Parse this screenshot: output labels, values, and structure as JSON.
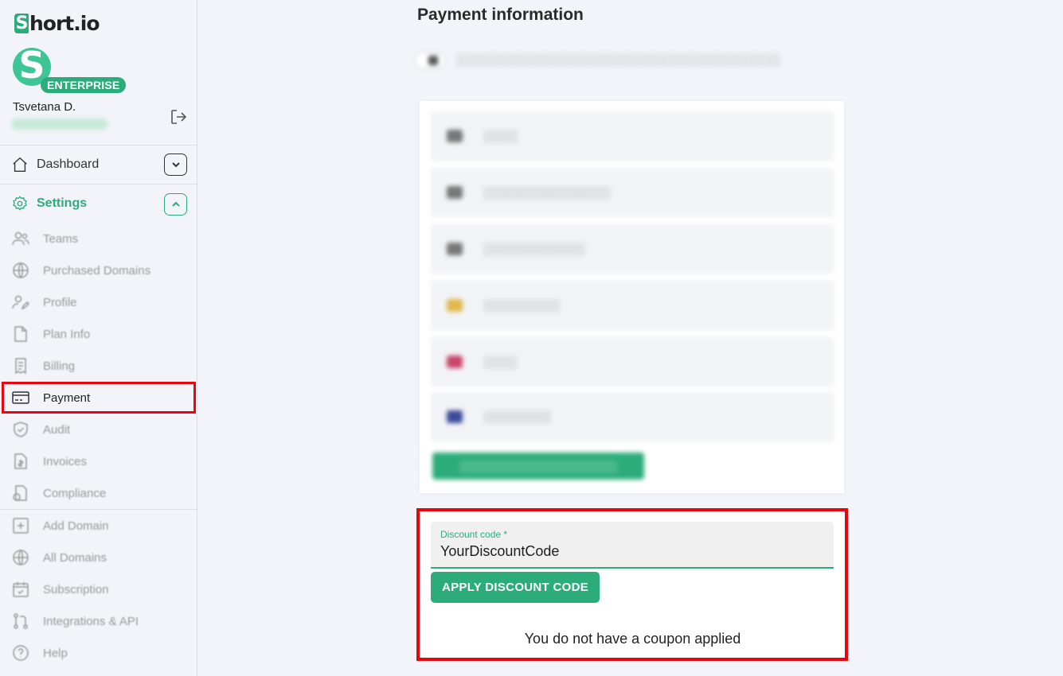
{
  "brand": {
    "logo_text": "hort.io",
    "logo_mark": "S",
    "accent": "#2cac7a",
    "highlight": "#e8050d"
  },
  "user": {
    "avatar_letter": "S",
    "plan_badge": "ENTERPRISE",
    "name": "Tsvetana D."
  },
  "nav": {
    "dashboard": "Dashboard",
    "settings": "Settings",
    "settings_items": [
      {
        "label": "Teams",
        "icon": "users-icon"
      },
      {
        "label": "Purchased Domains",
        "icon": "globe-icon"
      },
      {
        "label": "Profile",
        "icon": "user-edit-icon"
      },
      {
        "label": "Plan Info",
        "icon": "document-icon"
      },
      {
        "label": "Billing",
        "icon": "receipt-icon"
      },
      {
        "label": "Payment",
        "icon": "credit-card-icon"
      },
      {
        "label": "Audit",
        "icon": "shield-check-icon"
      },
      {
        "label": "Invoices",
        "icon": "invoice-icon"
      },
      {
        "label": "Compliance",
        "icon": "compliance-icon"
      }
    ],
    "bottom_items": [
      {
        "label": "Add Domain",
        "icon": "plus-square-icon"
      },
      {
        "label": "All Domains",
        "icon": "globe-icon"
      },
      {
        "label": "Subscription",
        "icon": "calendar-check-icon"
      },
      {
        "label": "Integrations & API",
        "icon": "git-icon"
      },
      {
        "label": "Help",
        "icon": "help-icon"
      }
    ]
  },
  "main": {
    "title": "Payment information",
    "discount": {
      "label": "Discount code *",
      "value": "YourDiscountCode",
      "apply_label": "APPLY DISCOUNT CODE",
      "status": "You do not have a coupon applied"
    }
  }
}
